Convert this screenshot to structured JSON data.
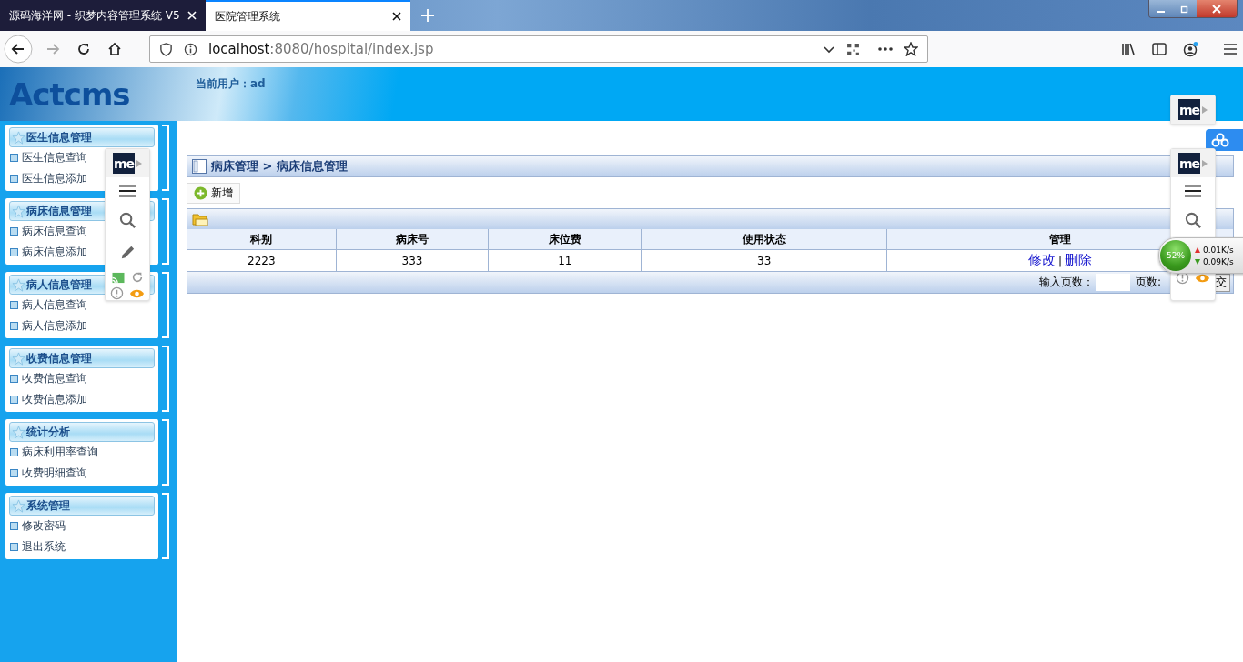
{
  "browser": {
    "tabs": [
      {
        "title": "源码海洋网 - 织梦内容管理系统 V5",
        "selected": false
      },
      {
        "title": "医院管理系统",
        "selected": true
      }
    ],
    "url_host": "localhost",
    "url_rest": ":8080/hospital/index.jsp"
  },
  "header": {
    "logo": "Actcms",
    "current_user": "当前用户：ad"
  },
  "sidebar": [
    {
      "title": "医生信息管理",
      "items": [
        "医生信息查询",
        "医生信息添加"
      ]
    },
    {
      "title": "病床信息管理",
      "items": [
        "病床信息查询",
        "病床信息添加"
      ]
    },
    {
      "title": "病人信息管理",
      "items": [
        "病人信息查询",
        "病人信息添加"
      ]
    },
    {
      "title": "收费信息管理",
      "items": [
        "收费信息查询",
        "收费信息添加"
      ]
    },
    {
      "title": "统计分析",
      "items": [
        "病床利用率查询",
        "收费明细查询"
      ]
    },
    {
      "title": "系统管理",
      "items": [
        "修改密码",
        "退出系统"
      ]
    }
  ],
  "breadcrumb": "病床管理 > 病床信息管理",
  "add_button": "新增",
  "table": {
    "columns": [
      "科别",
      "病床号",
      "床位费",
      "使用状态",
      "管理"
    ],
    "rows": [
      {
        "cells": [
          "2223",
          "333",
          "11",
          "33"
        ],
        "actions": [
          "修改",
          "删除"
        ],
        "separator": "|"
      }
    ]
  },
  "pager": {
    "label": "输入页数：",
    "pages_label": "页数:",
    "button": "交"
  },
  "overlays": {
    "badges": [
      "me",
      "me",
      "me"
    ],
    "net_meter": {
      "percent": "52%",
      "up": "0.01K/s",
      "down": "0.09K/s"
    }
  }
}
